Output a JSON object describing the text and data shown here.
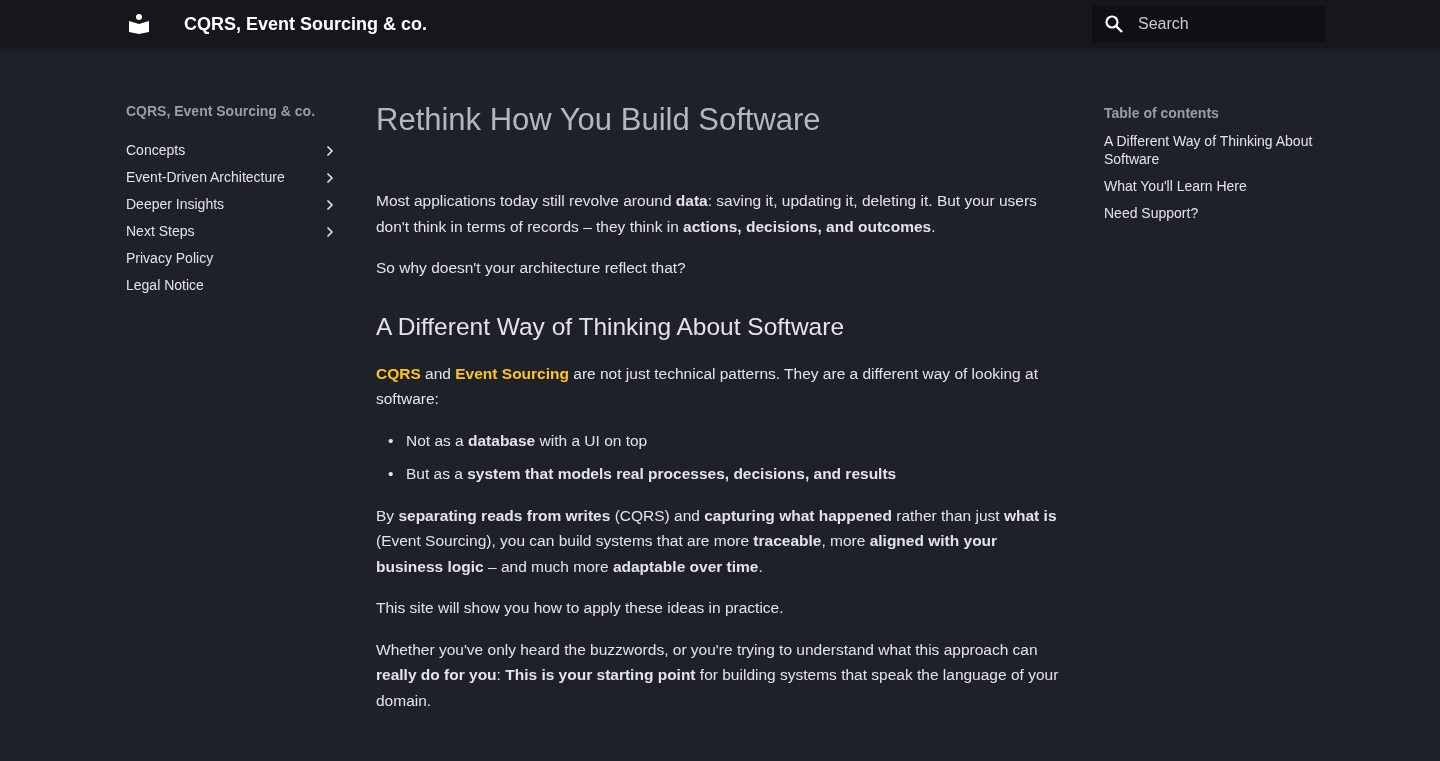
{
  "header": {
    "title": "CQRS, Event Sourcing & co.",
    "search": {
      "placeholder": "Search"
    }
  },
  "sidebar": {
    "title": "CQRS, Event Sourcing & co.",
    "items": [
      {
        "label": "Concepts",
        "expandable": true
      },
      {
        "label": "Event-Driven Architecture",
        "expandable": true
      },
      {
        "label": "Deeper Insights",
        "expandable": true
      },
      {
        "label": "Next Steps",
        "expandable": true
      },
      {
        "label": "Privacy Policy",
        "expandable": false
      },
      {
        "label": "Legal Notice",
        "expandable": false
      }
    ]
  },
  "content": {
    "title": "Rethink How You Build Software",
    "blocks": [
      {
        "kind": "paragraph",
        "parts": [
          {
            "kind": "text",
            "text": "Most applications today still revolve around **data**: saving it, updating it, deleting it. But your users don't think in terms of records – they think in **actions, decisions, and outcomes**."
          }
        ]
      },
      {
        "kind": "paragraph",
        "parts": [
          {
            "kind": "text",
            "text": "So why doesn't your architecture reflect that?"
          }
        ]
      },
      {
        "kind": "heading",
        "text": "A Different Way of Thinking About Software"
      },
      {
        "kind": "paragraph",
        "parts": [
          {
            "kind": "link",
            "text": "CQRS"
          },
          {
            "kind": "text",
            "text": " and "
          },
          {
            "kind": "link",
            "text": "Event Sourcing"
          },
          {
            "kind": "text",
            "text": " are not just technical patterns. They are a different way of looking at software:"
          }
        ]
      },
      {
        "kind": "list",
        "items": [
          {
            "marker": "•",
            "text": "Not as a **database** with a UI on top"
          },
          {
            "marker": "•",
            "text": "But as a **system that models real processes, decisions, and results**"
          }
        ]
      },
      {
        "kind": "paragraph",
        "parts": [
          {
            "kind": "text",
            "text": "By **separating reads from writes** (CQRS) and **capturing what happened** rather than just **what is** (Event Sourcing), you can build systems that are more **traceable**, more **aligned with your business logic** – and much more **adaptable over time**."
          }
        ]
      },
      {
        "kind": "paragraph",
        "parts": [
          {
            "kind": "text",
            "text": "This site will show you how to apply these ideas in practice."
          }
        ]
      },
      {
        "kind": "paragraph",
        "parts": [
          {
            "kind": "text",
            "text": "Whether you've only heard the buzzwords, or you're trying to understand what this approach can **really do for you**: **This is your starting point** for building systems that speak the language of your domain."
          }
        ]
      }
    ]
  },
  "toc": {
    "title": "Table of contents",
    "items": [
      "A Different Way of Thinking About Software",
      "What You'll Learn Here",
      "Need Support?"
    ]
  }
}
